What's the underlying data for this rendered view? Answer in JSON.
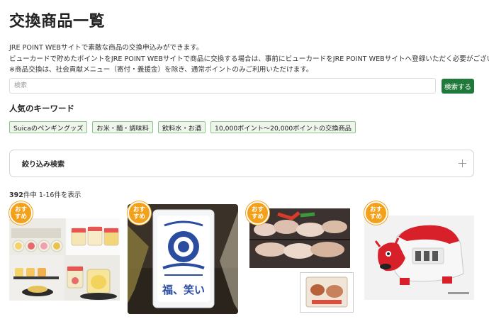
{
  "page": {
    "title": "交換商品一覧",
    "description": [
      "JRE POINT WEBサイトで素敵な商品の交換申込みができます。",
      "ビューカードで貯めたポイントをJRE POINT WEBサイトで商品に交換する場合は、事前にビューカードをJRE POINT WEBサイトへ登録いただく必要がございます。",
      "※商品交換は、社会貢献メニュー（寄付・義援金）を除き、通常ポイントのみご利用いただけます。"
    ]
  },
  "search": {
    "placeholder": "検索",
    "value": "",
    "button_label": "検索する"
  },
  "keywords": {
    "heading": "人気のキーワード",
    "tags": [
      "Suicaのペンギングッズ",
      "お米・麺・調味料",
      "飲料水・お酒",
      "10,000ポイント〜20,000ポイントの交換商品"
    ]
  },
  "filter": {
    "label": "絞り込み検索",
    "icon": "plus-icon"
  },
  "results": {
    "total": "392",
    "total_suffix": "件中 1-16件を表示"
  },
  "products": [
    {
      "badge_line1": "おす",
      "badge_line2": "すめ",
      "image": "jar-sweets-photo"
    },
    {
      "badge_line1": "おす",
      "badge_line2": "すめ",
      "image": "rice-bag-photo",
      "package_text": "福、笑い"
    },
    {
      "badge_line1": "おす",
      "badge_line2": "すめ",
      "image": "grilled-meat-photo"
    },
    {
      "badge_line1": "おす",
      "badge_line2": "すめ",
      "image": "train-akabeko-photo"
    }
  ],
  "colors": {
    "accent_green": "#1f7a3a",
    "tag_border": "#8bc28a",
    "tag_bg": "#eef6ec",
    "badge_orange": "#f3a01a"
  }
}
